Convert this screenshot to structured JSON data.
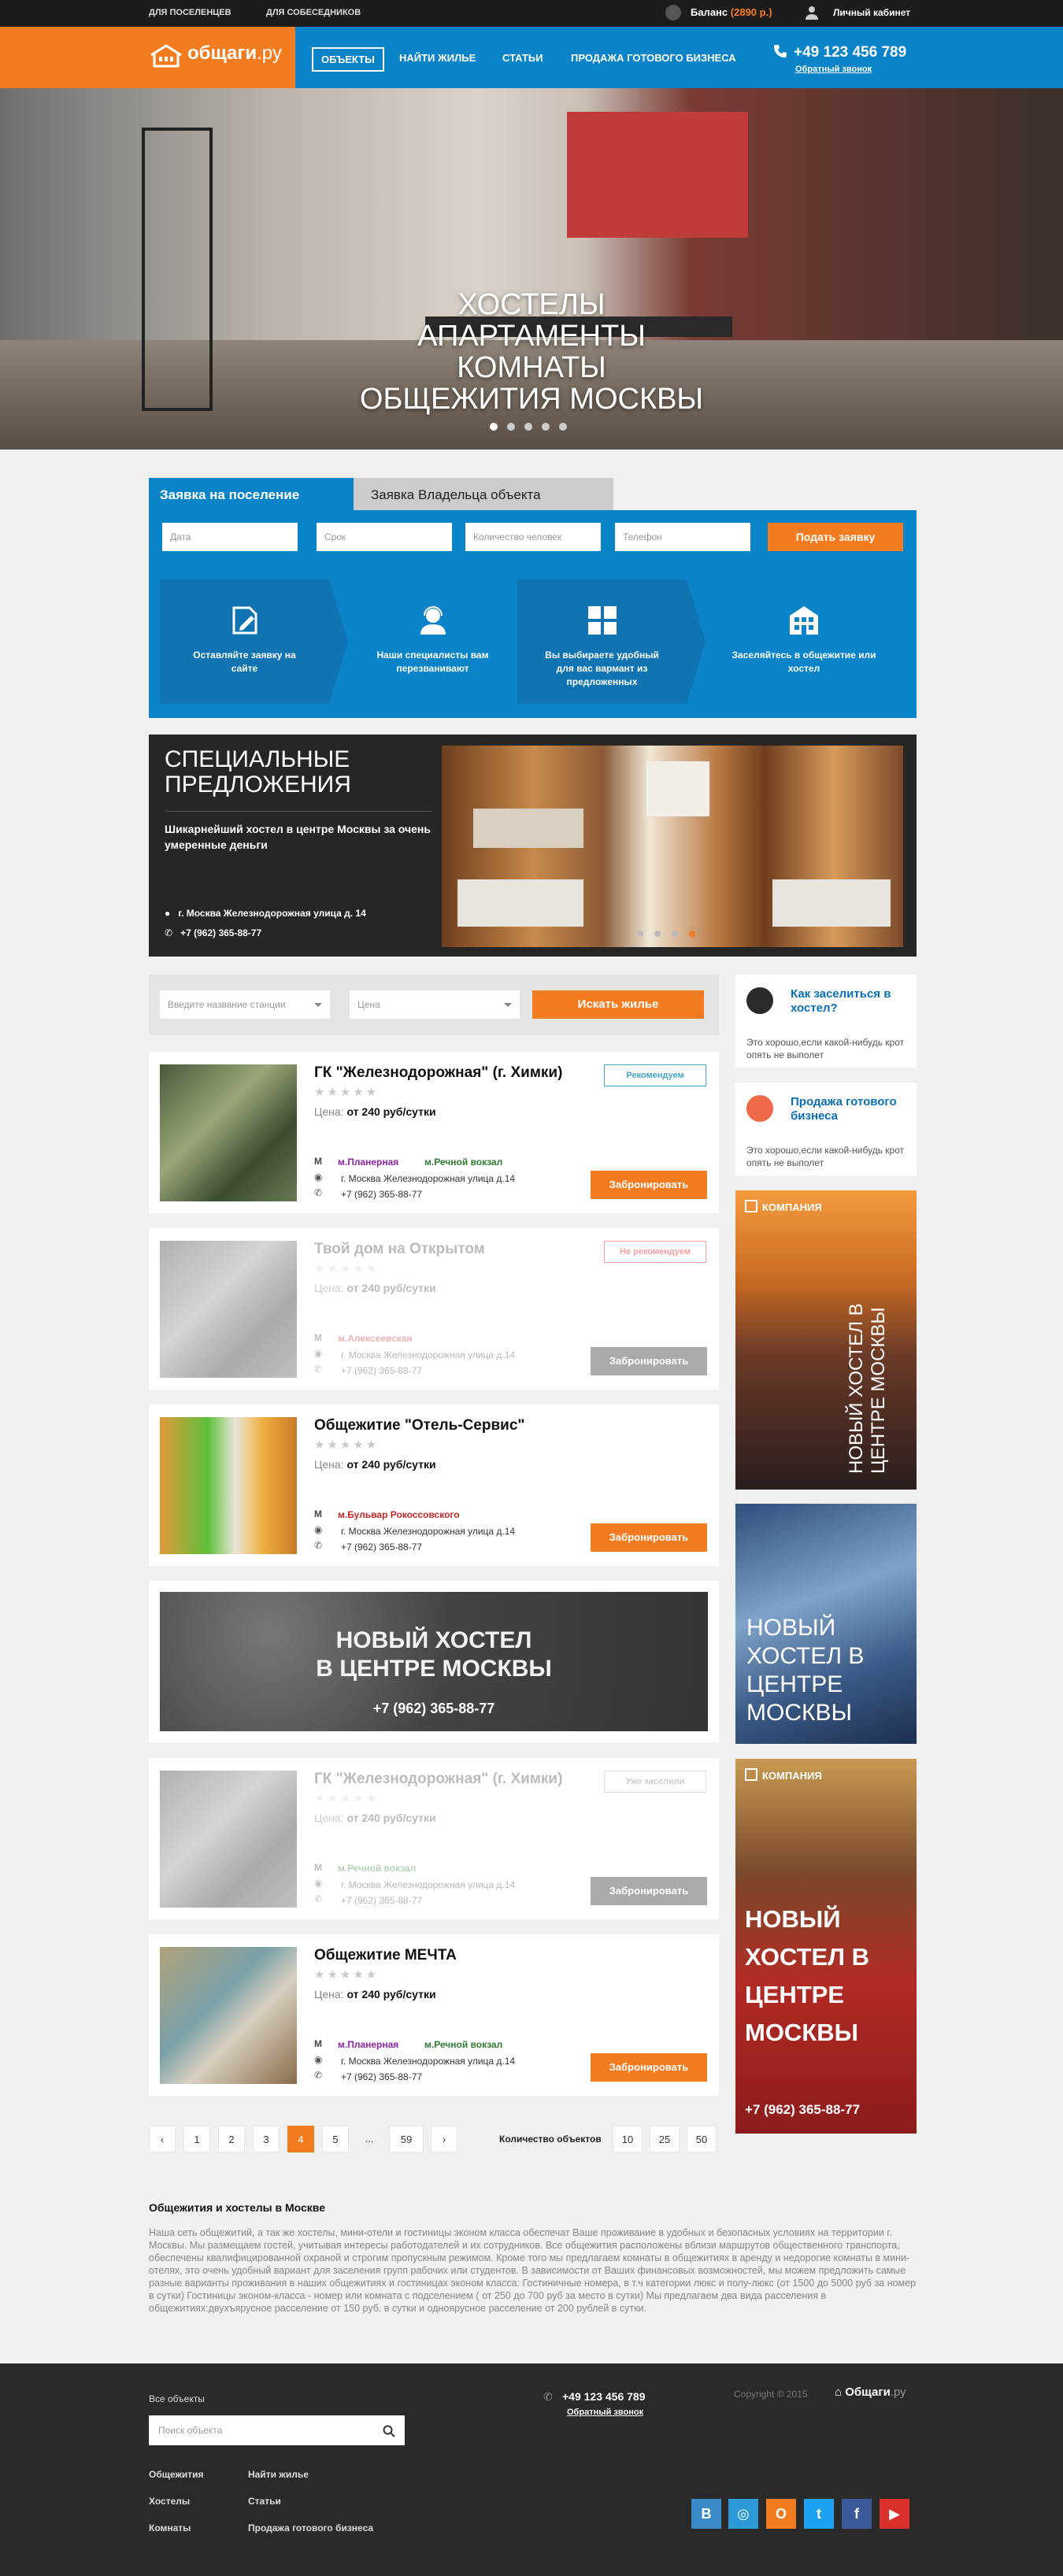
{
  "topbar": {
    "link1": "ДЛЯ ПОСЕЛЕНЦЕВ",
    "link2": "ДЛЯ СОБЕСЕДНИКОВ",
    "balance_label": "Баланс",
    "balance_value": "(2890 р.)",
    "cabinet": "Личный кабинет"
  },
  "header": {
    "logo": "общаги",
    "logo_tld": ".ру",
    "nav": [
      "ОБЪЕКТЫ",
      "НАЙТИ ЖИЛЬЕ",
      "СТАТЬИ",
      "ПРОДАЖА ГОТОВОГО БИЗНЕСА"
    ],
    "phone": "+49 123 456 789",
    "callback": "Обратный звонок"
  },
  "hero": {
    "lines": [
      "ХОСТЕЛЫ",
      "АПАРТАМЕНТЫ",
      "КОМНАТЫ",
      "ОБЩЕЖИТИЯ МОСКВЫ"
    ]
  },
  "request": {
    "tab_active": "Заявка на поселение",
    "tab_inactive": "Заявка Владельца объекта",
    "fields": [
      "Дата",
      "Срок",
      "Количество человек",
      "Телефон"
    ],
    "submit": "Подать заявку",
    "steps": [
      "Оставляйте заявку на сайте",
      "Наши специалисты вам перезванивают",
      "Вы выбираете удобный для вас вармант из предложенных",
      "Заселяйтесь в общежитие или хостел"
    ]
  },
  "special": {
    "title": "СПЕЦИАЛЬНЫЕ ПРЕДЛОЖЕНИЯ",
    "desc": "Шикарнейший хостел в центре Москвы за очень умеренные деньги",
    "address": "г. Москва Железнодорожная улица д. 14",
    "phone": "+7 (962) 365-88-77"
  },
  "filter": {
    "station_placeholder": "Введите название станции",
    "price_placeholder": "Цена",
    "button": "Искать жилье"
  },
  "listings": [
    {
      "name": "ГК \"Железнодорожная\" (г. Химки)",
      "price_label": "Цена:",
      "price": "от 240 руб/сутки",
      "metro1": "м.Планерная",
      "metro2": "м.Речной вокзал",
      "address": "г. Москва Железнодорожная улица д.14",
      "phone": "+7 (962) 365-88-77",
      "book": "Забронировать",
      "tag": "Рекомендуем"
    },
    {
      "name": "Твой дом на Открытом",
      "price_label": "Цена:",
      "price": "от 240 руб/сутки",
      "metro1": "м.Алексеевская",
      "metro2": "",
      "address": "г. Москва Железнодорожная улица д.14",
      "phone": "+7 (962) 365-88-77",
      "book": "Забронировать",
      "tag": "Не рекомендуем"
    },
    {
      "name": "Общежитие \"Отель-Сервис\"",
      "price_label": "Цена:",
      "price": "от 240 руб/сутки",
      "metro1": "м.Бульвар Рокоссовского",
      "metro2": "",
      "address": "г. Москва Железнодорожная улица д.14",
      "phone": "+7 (962) 365-88-77",
      "book": "Забронировать",
      "tag": ""
    },
    {
      "name": "ГК \"Железнодорожная\" (г. Химки)",
      "price_label": "Цена:",
      "price": "от 240 руб/сутки",
      "metro1": "м.Речной вокзал",
      "metro2": "",
      "address": "г. Москва Железнодорожная улица д.14",
      "phone": "+7 (962) 365-88-77",
      "book": "Забронировать",
      "tag": "Уже заселили"
    },
    {
      "name": "Общежитие МЕЧТА",
      "price_label": "Цена:",
      "price": "от 240 руб/сутки",
      "metro1": "м.Планерная",
      "metro2": "м.Речной вокзал",
      "address": "г. Москва Железнодорожная улица д.14",
      "phone": "+7 (962) 365-88-77",
      "book": "Забронировать",
      "tag": ""
    }
  ],
  "banner": {
    "line1": "НОВЫЙ ХОСТЕЛ",
    "line2": "В ЦЕНТРЕ МОСКВЫ",
    "phone": "+7 (962) 365-88-77"
  },
  "pagination": {
    "pages": [
      "1",
      "2",
      "3",
      "4",
      "5",
      "...",
      "59"
    ],
    "current": "4",
    "count_label": "Количество объектов",
    "sizes": [
      "10",
      "25",
      "50"
    ]
  },
  "sidebar": {
    "box1": {
      "title": "Как заселиться в хостел?",
      "desc": "Это хорошо,если какой-нибудь крот опять не выполет"
    },
    "box2": {
      "title": "Продажа готового бизнеса",
      "desc": "Это хорошо,если какой-нибудь крот опять не выполет"
    },
    "ad1": {
      "label": "КОМПАНИЯ",
      "text": "НОВЫЙ ХОСТЕЛ В ЦЕНТРЕ МОСКВЫ"
    },
    "ad2": {
      "text": "НОВЫЙ ХОСТЕЛ В ЦЕНТРЕ МОСКВЫ"
    },
    "ad3": {
      "label": "КОМПАНИЯ",
      "text": "НОВЫЙ ХОСТЕЛ В ЦЕНТРЕ МОСКВЫ",
      "phone": "+7 (962) 365-88-77"
    }
  },
  "seo": {
    "title": "Общежития и хостелы в Москве",
    "text": "Наша сеть общежитий, а так же хостелы, мини-отели и гостиницы эконом класса обеспечат Ваше проживание в удобных и безопасных условиях на территории г. Москвы. Мы размещаем гостей, учитывая интересы работодателей и их сотрудников. Все общежития расположены вблизи маршрутов общественного транспорта, обеспечены квалифицированной охраной и строгим пропускным режимом. Кроме того мы предлагаем комнаты в общежитиях в аренду и недорогие комнаты в мини-отелях, это очень удобный вариант для заселения групп рабочих или студентов. В зависимости от Ваших финансовых возможностей, мы можем предложить самые разные варианты проживания в наших общежитиях и гостиницах эконом класса: Гостиничные номера, в т.ч категории люкс и полу-люкс (от 1500 до 5000 руб за номер в сутки) Гостиницы эконом-класса - номер или комната с подселением ( от 250 до 700 руб за место в сутки) Мы предлагаем два вида расселения в общежитиях:двухъярусное расселение от 150 руб. в сутки и одноярусное расселение от 200 рублей в сутки."
  },
  "footer": {
    "all_objects": "Все объекты",
    "search_placeholder": "Поиск объекта",
    "links": [
      "Общежития",
      "Найти жилье",
      "Хостелы",
      "Статьи",
      "Комнаты",
      "Продажа готового бизнеса"
    ],
    "phone": "+49 123 456 789",
    "callback": "Обратный звонок",
    "copyright": "Copyright © 2015",
    "logo": "Общаги",
    "logo_tld": ".ру",
    "social": [
      "vk-icon",
      "instagram-icon",
      "odnoklassniki-icon",
      "twitter-icon",
      "facebook-icon",
      "youtube-icon"
    ]
  },
  "colors": {
    "accent": "#f47c20",
    "brand": "#0a84c8",
    "dark": "#262626"
  }
}
